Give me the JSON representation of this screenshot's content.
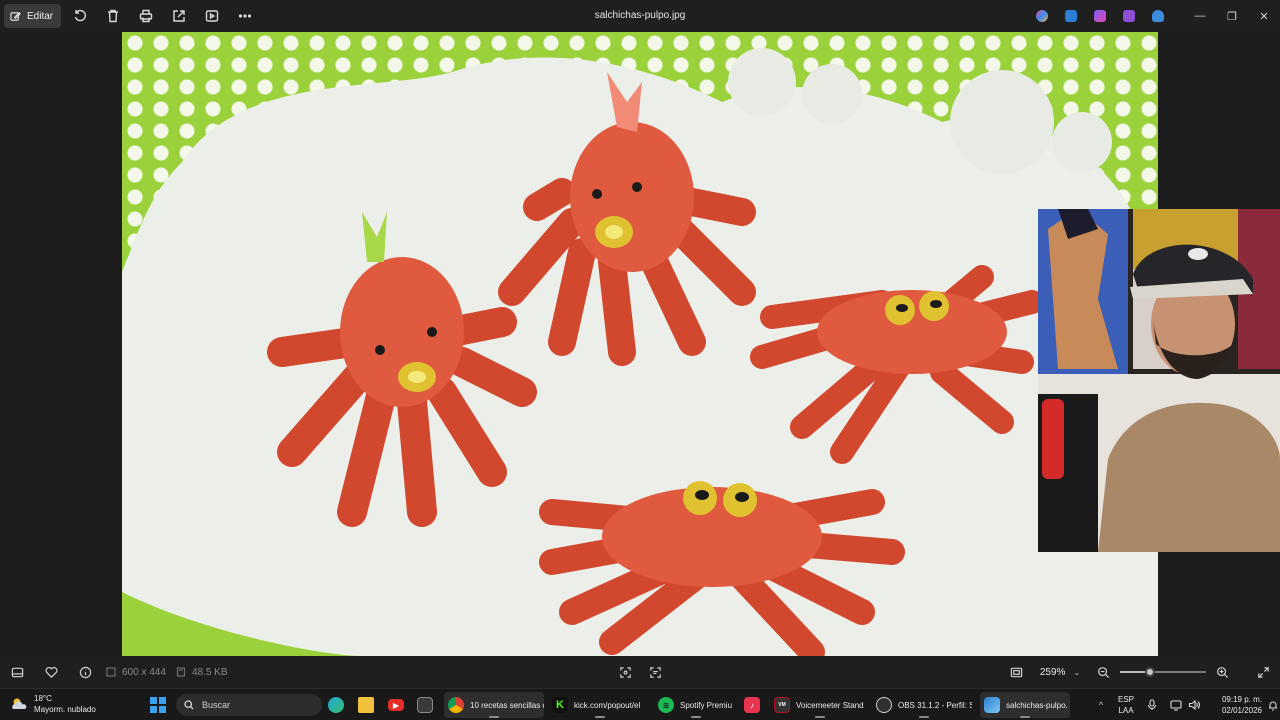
{
  "toolbar": {
    "edit_label": "Editar",
    "file_title": "salchichas-pulpo.jpg",
    "icons": [
      "rotate-icon",
      "delete-icon",
      "print-icon",
      "share-icon",
      "slideshow-icon",
      "more-icon"
    ]
  },
  "viewer": {
    "dimensions": "600 x 444",
    "file_size": "48.5 KB",
    "zoom": "259%",
    "zoom_level": 0.35
  },
  "taskbar": {
    "weather_temp": "18°C",
    "weather_desc": "Mayorm. nublado",
    "search_placeholder": "Buscar",
    "apps": [
      {
        "label": "10 recetas sencillas c",
        "color": "#4285f4"
      },
      {
        "label": "kick.com/popout/el",
        "color": "#53fc18"
      },
      {
        "label": "Spotify Premiu",
        "color": "#1db954"
      },
      {
        "label": "Voicemeeter Stand",
        "color": "#333333"
      },
      {
        "label": "OBS 31.1.2 - Perfil: S",
        "color": "#302e31"
      },
      {
        "label": "salchichas-pulpo.",
        "color": "#2a7fd4"
      }
    ],
    "language": "ESP",
    "language_sub": "LAA",
    "time": "09:19 p. m.",
    "date": "02/01/2026"
  }
}
